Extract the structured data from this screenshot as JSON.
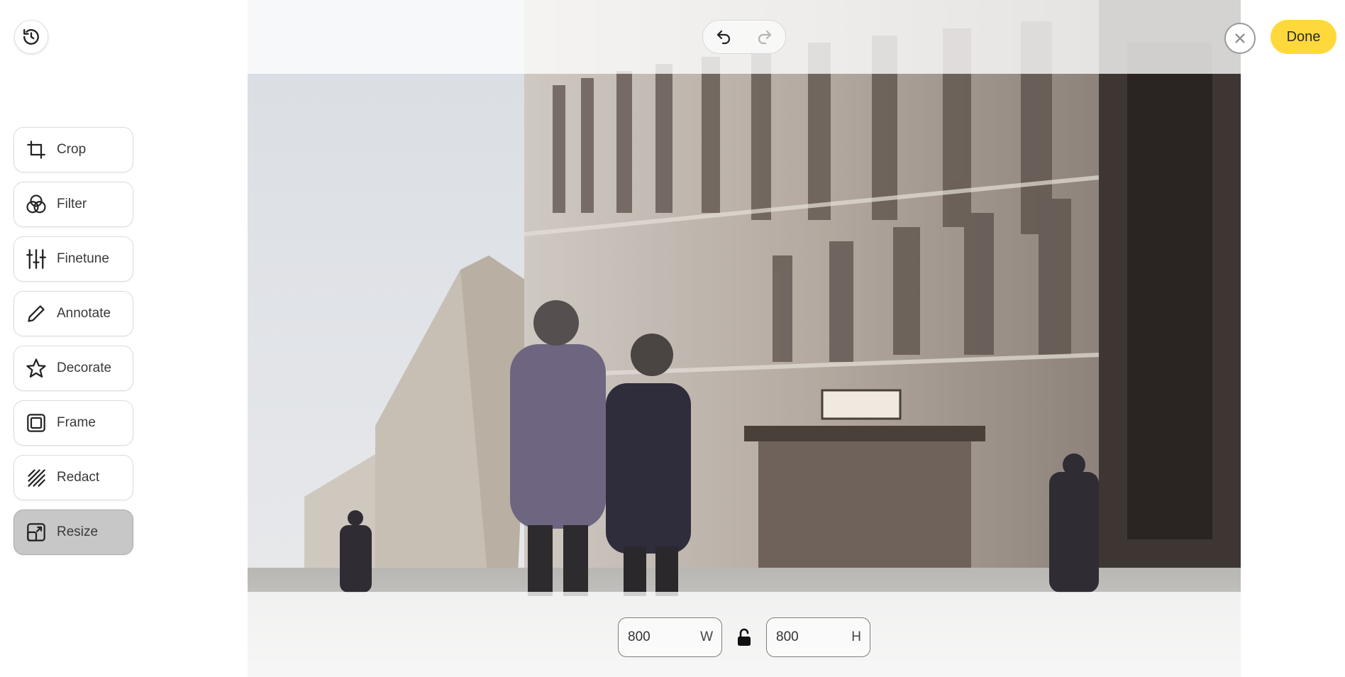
{
  "tools": [
    {
      "label": "Crop",
      "icon": "crop-icon"
    },
    {
      "label": "Filter",
      "icon": "filter-icon"
    },
    {
      "label": "Finetune",
      "icon": "sliders-icon"
    },
    {
      "label": "Annotate",
      "icon": "pencil-icon"
    },
    {
      "label": "Decorate",
      "icon": "star-icon"
    },
    {
      "label": "Frame",
      "icon": "frame-icon"
    },
    {
      "label": "Redact",
      "icon": "redact-icon"
    },
    {
      "label": "Resize",
      "icon": "resize-icon",
      "active": true
    }
  ],
  "header": {
    "done_label": "Done"
  },
  "resize": {
    "width_value": "800",
    "width_unit": "W",
    "height_value": "800",
    "height_unit": "H"
  },
  "colors": {
    "accent": "#ffd93b",
    "active_tool": "#c7c7c7"
  }
}
